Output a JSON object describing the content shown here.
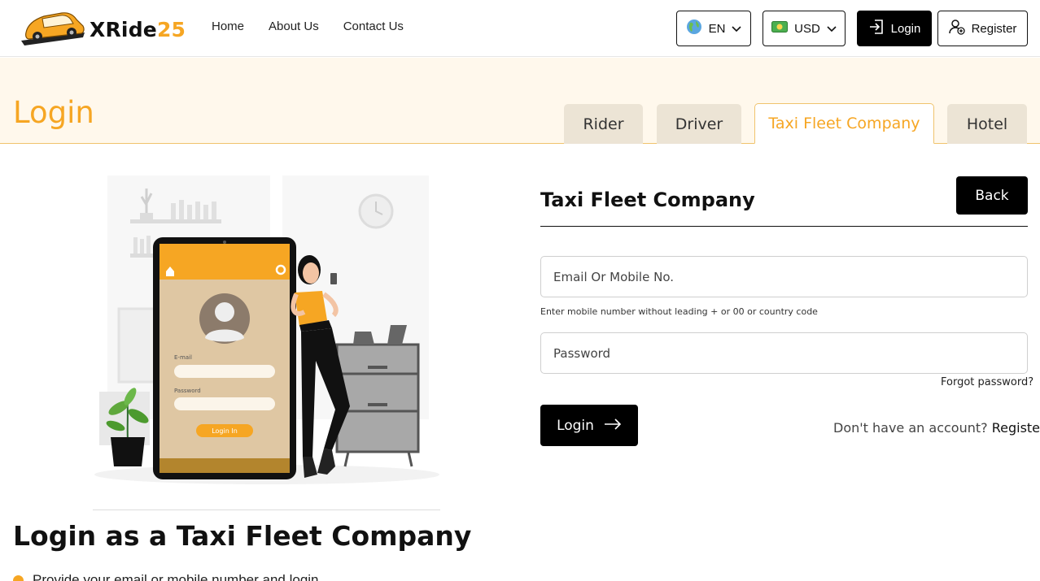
{
  "brand": {
    "name": "XRide",
    "number": "25",
    "logo_icon": "car-logo-icon"
  },
  "nav": [
    {
      "label": "Home"
    },
    {
      "label": "About Us"
    },
    {
      "label": "Contact Us"
    }
  ],
  "header_controls": {
    "language": "EN",
    "currency": "USD",
    "login": "Login",
    "register": "Register"
  },
  "banner": {
    "title": "Login",
    "tabs": [
      {
        "label": "Rider"
      },
      {
        "label": "Driver"
      },
      {
        "label": "Taxi Fleet Company",
        "active": true
      },
      {
        "label": "Hotel"
      }
    ]
  },
  "illustration": {
    "phone_email_label": "E-mail",
    "phone_password_label": "Password",
    "phone_button_label": "Login In"
  },
  "left": {
    "heading": "Login as a Taxi Fleet Company",
    "bullet_text": "Provide your email or mobile number and login"
  },
  "form": {
    "title": "Taxi Fleet Company",
    "back_label": "Back",
    "email_placeholder": "Email Or Mobile No.",
    "hint": "Enter mobile number without leading + or 00 or country code",
    "password_placeholder": "Password",
    "forgot": "Forgot password?",
    "login_label": "Login",
    "no_account": "Don't have an account?",
    "register_link": "Register"
  },
  "colors": {
    "accent": "#f6a623",
    "banner_bg": "#fff8ec",
    "tab_bg": "#ece4d5"
  }
}
